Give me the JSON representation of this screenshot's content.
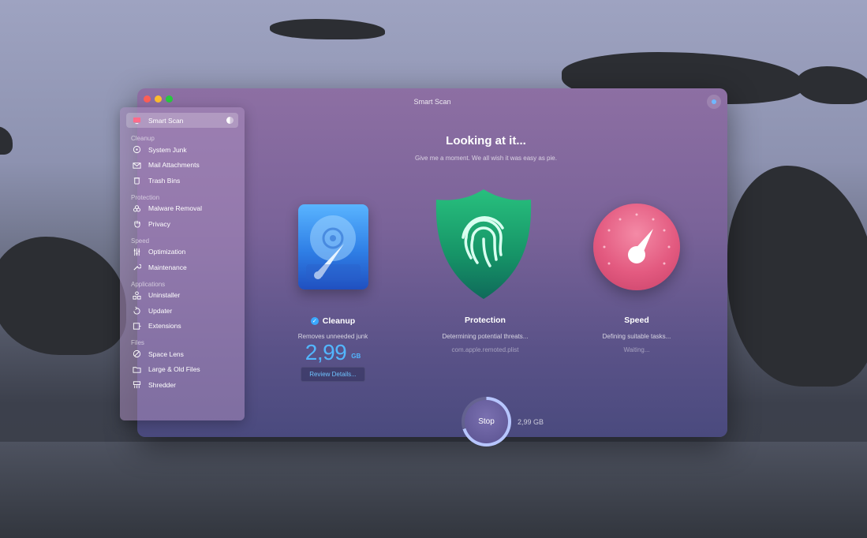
{
  "window": {
    "title": "Smart Scan"
  },
  "sidebar": {
    "top_item": {
      "label": "Smart Scan",
      "icon": "monitor-icon"
    },
    "sections": [
      {
        "title": "Cleanup",
        "items": [
          {
            "label": "System Junk",
            "icon": "disk-icon"
          },
          {
            "label": "Mail Attachments",
            "icon": "mail-icon"
          },
          {
            "label": "Trash Bins",
            "icon": "trash-icon"
          }
        ]
      },
      {
        "title": "Protection",
        "items": [
          {
            "label": "Malware Removal",
            "icon": "biohazard-icon"
          },
          {
            "label": "Privacy",
            "icon": "hand-icon"
          }
        ]
      },
      {
        "title": "Speed",
        "items": [
          {
            "label": "Optimization",
            "icon": "sliders-icon"
          },
          {
            "label": "Maintenance",
            "icon": "wrench-icon"
          }
        ]
      },
      {
        "title": "Applications",
        "items": [
          {
            "label": "Uninstaller",
            "icon": "apps-icon"
          },
          {
            "label": "Updater",
            "icon": "update-icon"
          },
          {
            "label": "Extensions",
            "icon": "extension-icon"
          }
        ]
      },
      {
        "title": "Files",
        "items": [
          {
            "label": "Space Lens",
            "icon": "lens-icon"
          },
          {
            "label": "Large & Old Files",
            "icon": "folder-icon"
          },
          {
            "label": "Shredder",
            "icon": "shredder-icon"
          }
        ]
      }
    ]
  },
  "main": {
    "headline": "Looking at it...",
    "subline": "Give me a moment. We all wish it was easy as pie."
  },
  "modules": {
    "cleanup": {
      "title": "Cleanup",
      "description": "Removes unneeded junk",
      "size_value": "2,99",
      "size_unit": "GB",
      "review_label": "Review Details..."
    },
    "protection": {
      "title": "Protection",
      "description": "Determining potential threats...",
      "detail": "com.apple.remoted.plist"
    },
    "speed": {
      "title": "Speed",
      "description": "Defining suitable tasks...",
      "detail": "Waiting..."
    }
  },
  "footer": {
    "stop_label": "Stop",
    "total_size": "2,99 GB",
    "progress": 0.7
  },
  "colors": {
    "accent_blue": "#52b6ff",
    "shield_green": "#1aa36b",
    "gauge_pink": "#e35a80"
  }
}
